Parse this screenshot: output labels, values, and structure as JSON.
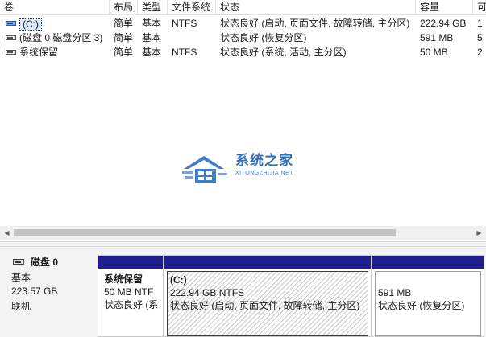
{
  "volume_table": {
    "columns": [
      "卷",
      "布局",
      "类型",
      "文件系统",
      "状态",
      "容量",
      "可"
    ],
    "rows": [
      {
        "name": "(C:)",
        "layout": "简单",
        "type": "基本",
        "fs": "NTFS",
        "status": "状态良好 (启动, 页面文件, 故障转储, 主分区)",
        "capacity": "222.94 GB",
        "free": "1",
        "selected": true
      },
      {
        "name": "(磁盘 0 磁盘分区 3)",
        "layout": "简单",
        "type": "基本",
        "fs": "",
        "status": "状态良好 (恢复分区)",
        "capacity": "591 MB",
        "free": "5",
        "selected": false
      },
      {
        "name": "系统保留",
        "layout": "简单",
        "type": "基本",
        "fs": "NTFS",
        "status": "状态良好 (系统, 活动, 主分区)",
        "capacity": "50 MB",
        "free": "2",
        "selected": false
      }
    ]
  },
  "watermark": {
    "title": "系统之家",
    "url": "XITONGZHIJIA.NET",
    "color": "#3f7fc8"
  },
  "disk": {
    "name": "磁盘 0",
    "type": "基本",
    "size": "223.57 GB",
    "status": "联机",
    "partitions": [
      {
        "name": "系统保留",
        "size_fs": "50 MB NTF",
        "status": "状态良好 (系"
      },
      {
        "name": "(C:)",
        "size_fs": "222.94 GB NTFS",
        "status": "状态良好 (启动, 页面文件, 故障转储, 主分区)"
      },
      {
        "name": "",
        "size_fs": "591 MB",
        "status": "状态良好 (恢复分区)"
      }
    ]
  },
  "colors": {
    "partition_bar": "#1e1e8c",
    "selection": "#ddeaff"
  }
}
